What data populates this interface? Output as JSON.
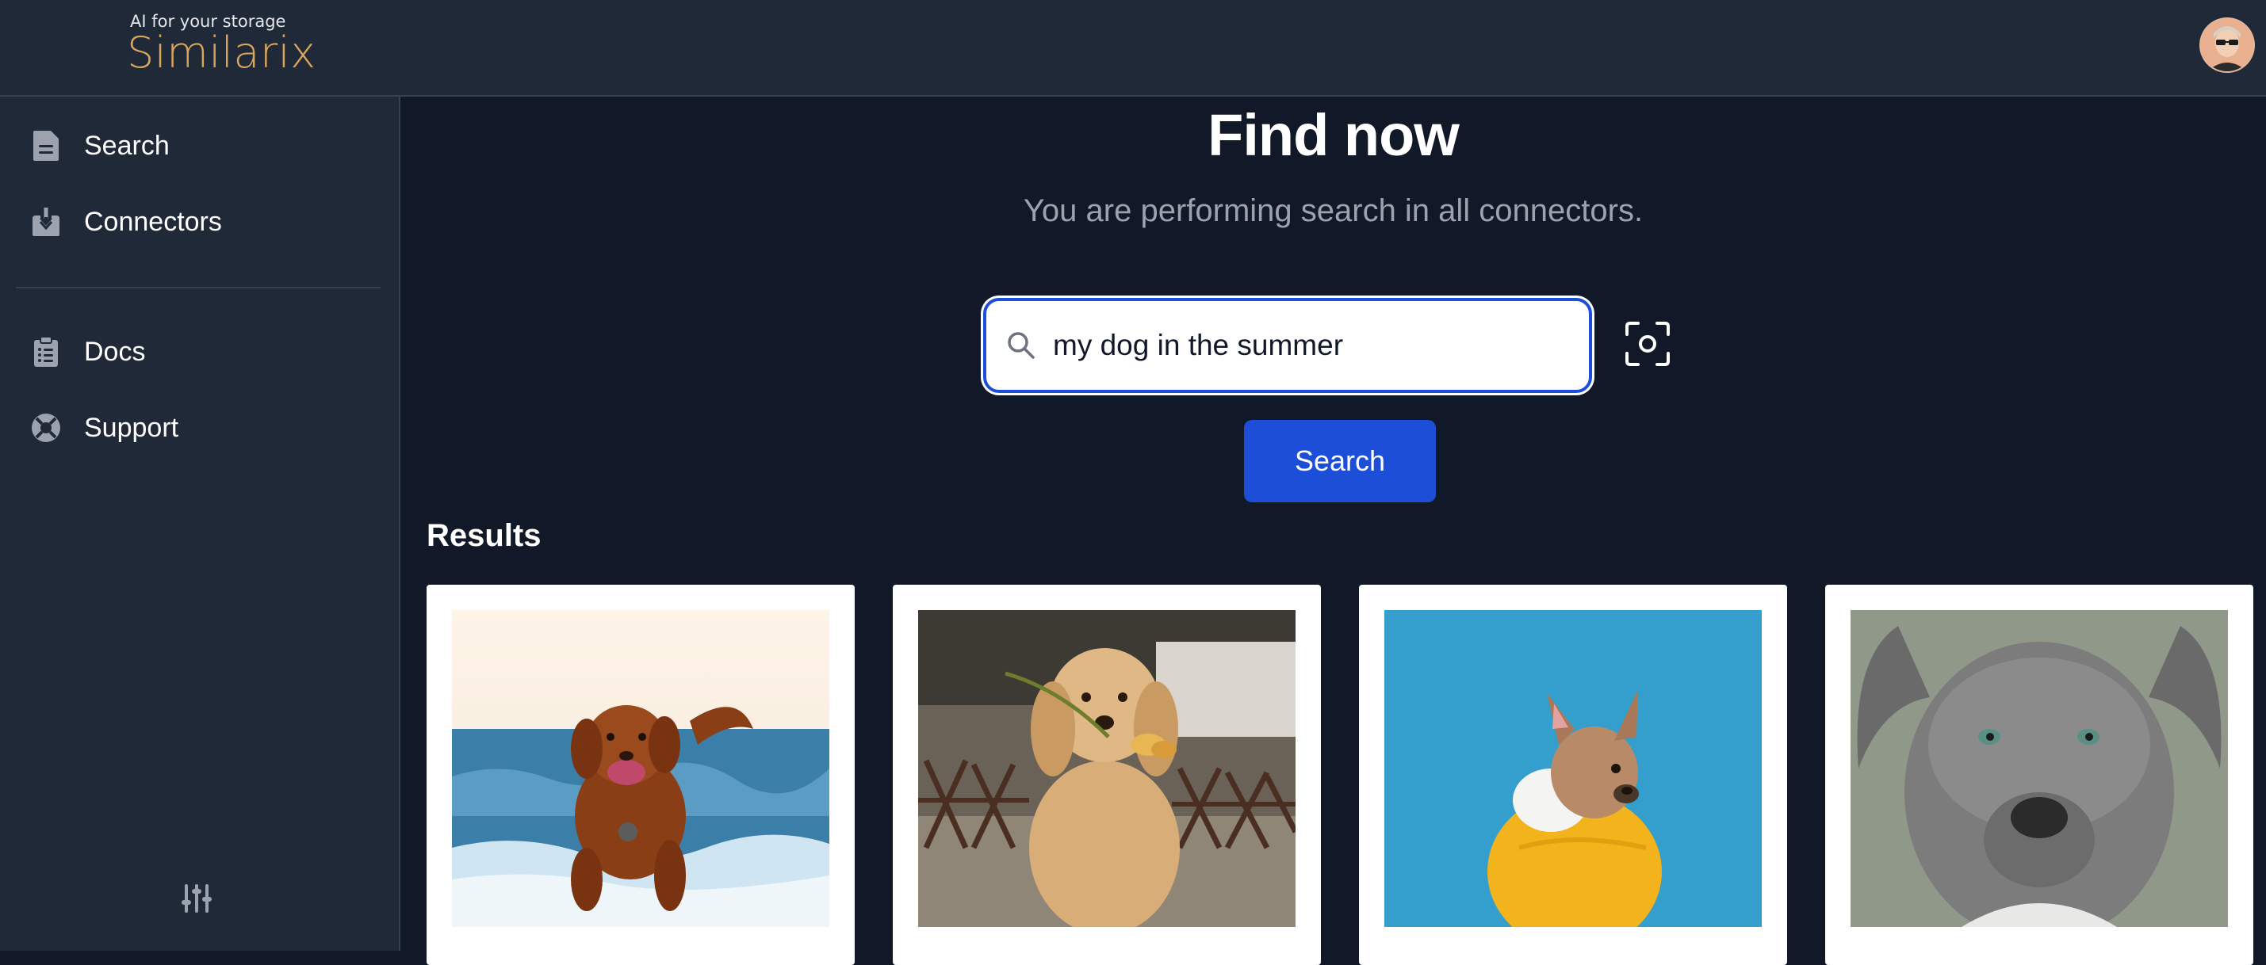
{
  "brand": {
    "tagline": "AI for your storage",
    "name": "Similarix"
  },
  "user": {
    "avatar": "avatar-image"
  },
  "sidebar": {
    "items": [
      {
        "label": "Search",
        "icon": "document-icon"
      },
      {
        "label": "Connectors",
        "icon": "inbox-download-icon"
      },
      {
        "label": "Docs",
        "icon": "clipboard-list-icon"
      },
      {
        "label": "Support",
        "icon": "lifebuoy-icon"
      }
    ],
    "settings_icon": "adjustments-sliders-icon"
  },
  "main": {
    "title": "Find now",
    "subtitle": "You are performing search in all connectors.",
    "search": {
      "value": "my dog in the summer",
      "placeholder": ""
    },
    "search_button": "Search",
    "camera_icon": "image-search-camera-icon",
    "results_title": "Results",
    "results": [
      {
        "alt": "brown dog running on the beach"
      },
      {
        "alt": "golden retriever holding a rose"
      },
      {
        "alt": "french bulldog in yellow hoodie"
      },
      {
        "alt": "grey pit bull portrait"
      }
    ]
  },
  "colors": {
    "background": "#111827",
    "panel": "#1f2937",
    "accent": "#1d4ed8",
    "brand": "#d9a65c"
  }
}
